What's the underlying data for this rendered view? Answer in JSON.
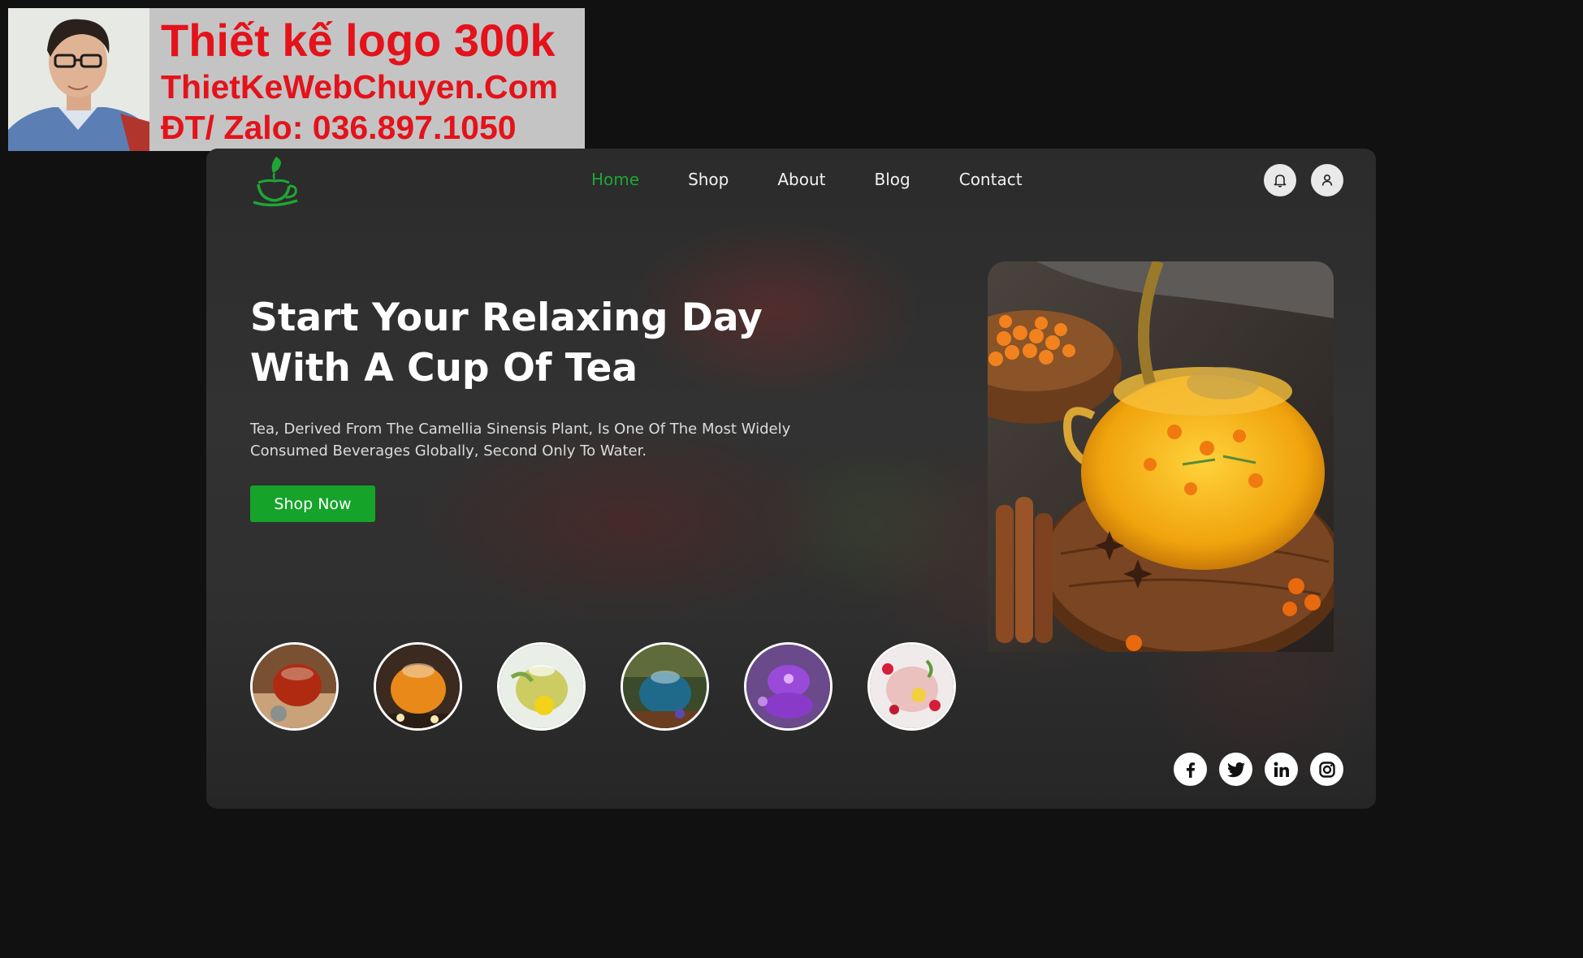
{
  "ad": {
    "line1": "Thiết kế logo 300k",
    "line2": "ThietKeWebChuyen.Com",
    "line3": "ĐT/ Zalo: 036.897.1050"
  },
  "nav": {
    "items": [
      {
        "label": "Home",
        "active": true
      },
      {
        "label": "Shop",
        "active": false
      },
      {
        "label": "About",
        "active": false
      },
      {
        "label": "Blog",
        "active": false
      },
      {
        "label": "Contact",
        "active": false
      }
    ],
    "icons": [
      "bell-icon",
      "user-icon"
    ]
  },
  "hero": {
    "title_line1": "Start Your Relaxing Day",
    "title_line2": "With A Cup Of Tea",
    "description_line1": "Tea, Derived From The Camellia Sinensis Plant, Is One Of The Most Widely",
    "description_line2": "Consumed Beverages Globally, Second Only To Water.",
    "cta_label": "Shop Now"
  },
  "thumbnails": [
    {
      "name": "red-tea"
    },
    {
      "name": "amber-tea"
    },
    {
      "name": "lemon-green-tea"
    },
    {
      "name": "blue-tea"
    },
    {
      "name": "purple-tea"
    },
    {
      "name": "berry-tea"
    }
  ],
  "social": [
    "facebook-icon",
    "twitter-icon",
    "linkedin-icon",
    "instagram-icon"
  ],
  "colors": {
    "accent": "#1ea634",
    "button": "#15a32a",
    "page_bg": "#111111",
    "ad_text": "#e4121b"
  }
}
